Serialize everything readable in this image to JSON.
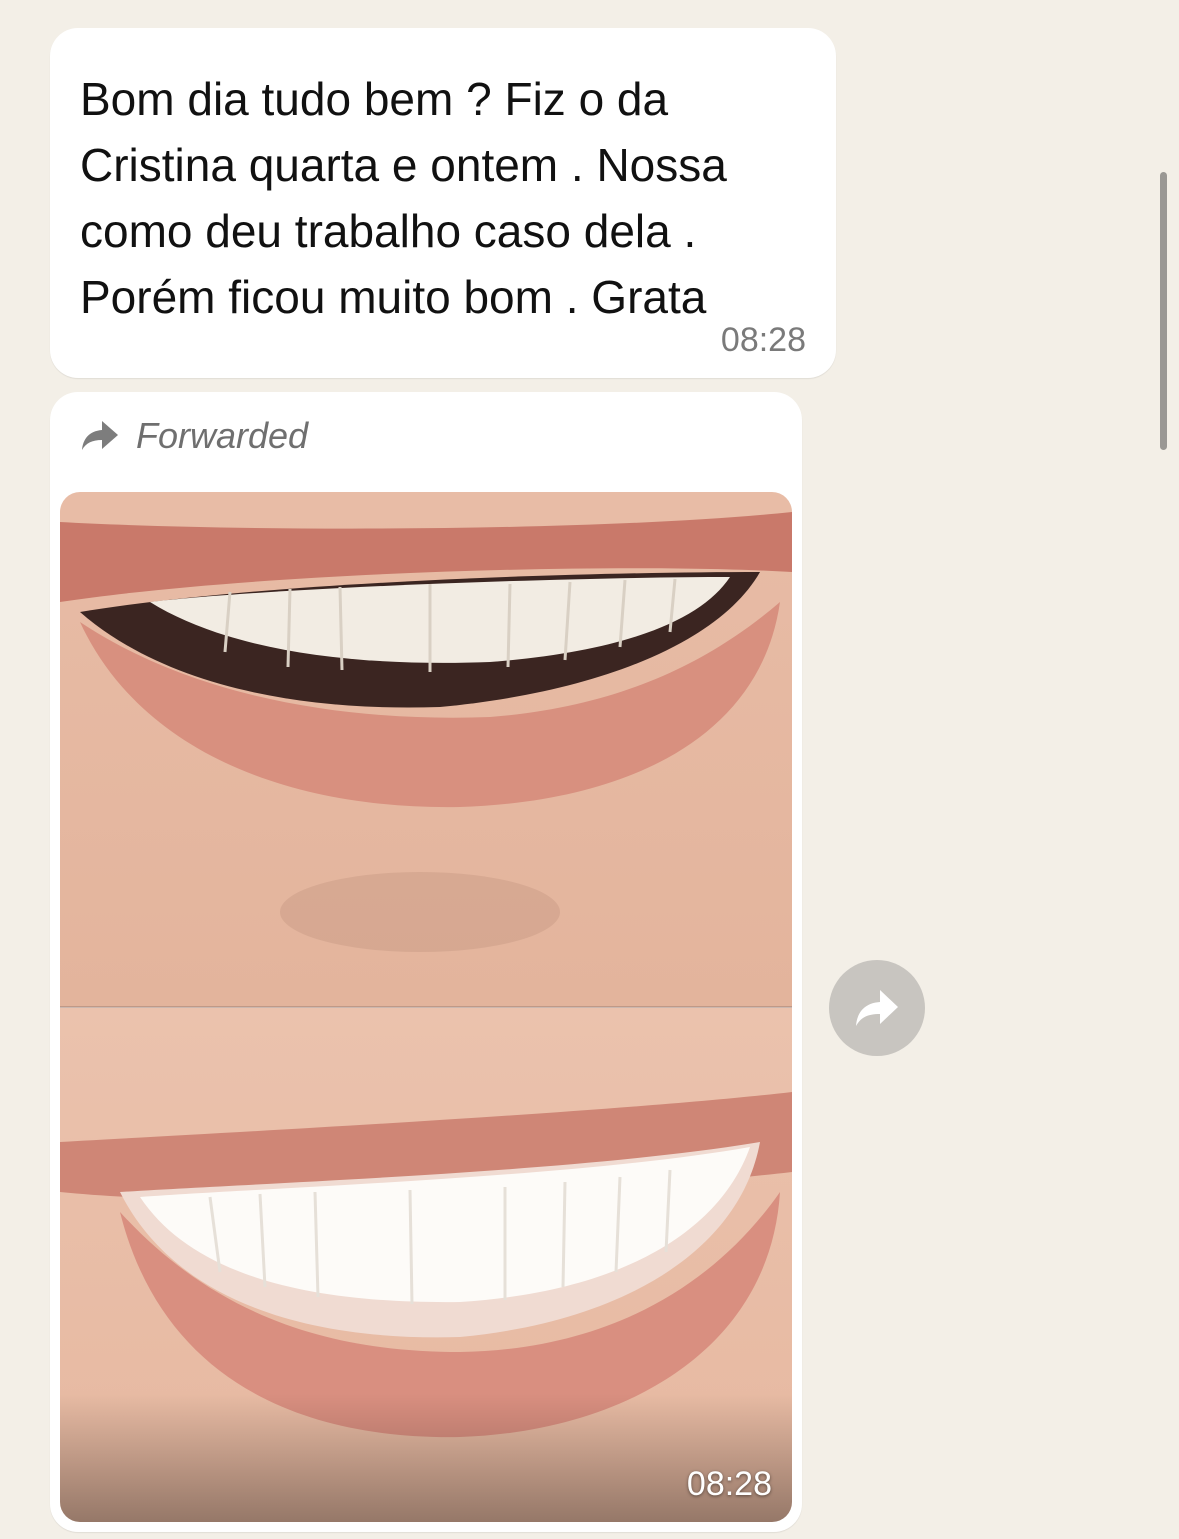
{
  "messages": [
    {
      "text": "Bom dia tudo bem ?  Fiz o da\nCristina quarta e ontem . Nossa\ncomo deu trabalho caso dela .\nPorém ficou muito bom . Grata",
      "time": "08:28"
    }
  ],
  "media_message": {
    "forwarded_label": "Forwarded",
    "time": "08:28",
    "image_description_icon": "before-after-smile-photo"
  },
  "actions": {
    "share_icon": "forward-share-icon"
  },
  "colors": {
    "background": "#f3efe7",
    "bubble": "#ffffff",
    "timestamp": "#7a7a7a",
    "share_button": "#c8c5c0"
  }
}
